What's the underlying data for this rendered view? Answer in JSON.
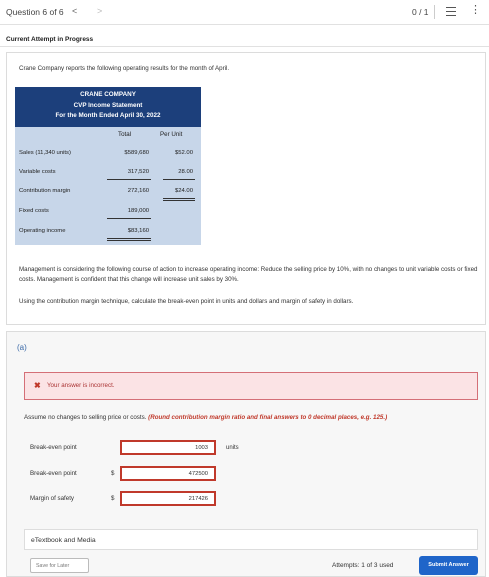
{
  "header": {
    "question_label": "Question 6 of 6",
    "prev_arrow": "<",
    "next_arrow": ">",
    "score": "0 / 1",
    "list_icon": "list-icon",
    "more_icon": "more-vertical-icon"
  },
  "status": "Current Attempt in Progress",
  "question": {
    "intro": "Crane Company reports the following operating results for the month of April.",
    "statement": {
      "company": "CRANE COMPANY",
      "title": "CVP Income Statement",
      "period": "For the Month Ended April 30, 2022",
      "col_total": "Total",
      "col_per_unit": "Per Unit",
      "rows": [
        {
          "label": "Sales (11,340 units)",
          "total": "$589,680",
          "per_unit": "$52.00"
        },
        {
          "label": "Variable costs",
          "total": "317,520",
          "per_unit": "28.00"
        },
        {
          "label": "Contribution margin",
          "total": "272,160",
          "per_unit": "$24.00"
        },
        {
          "label": "Fixed costs",
          "total": "189,000",
          "per_unit": ""
        },
        {
          "label": "Operating income",
          "total": "$83,160",
          "per_unit": ""
        }
      ]
    },
    "management": "Management is considering the following course of action to increase operating income: Reduce the selling price by 10%, with no changes to unit variable costs or fixed costs. Management is confident that this change will increase unit sales by 30%.",
    "instruction": "Using the contribution margin technique, calculate the break-even point in units and dollars and margin of safety in dollars."
  },
  "part_a": {
    "label": "(a)",
    "alert_message": "Your answer is incorrect.",
    "assume_text": "Assume no changes to selling price or costs.",
    "assume_note": "(Round contribution margin ratio and final answers to 0 decimal places, e.g. 125.)",
    "answers": [
      {
        "label": "Break-even point",
        "prefix": "",
        "value": "1003",
        "suffix": "units"
      },
      {
        "label": "Break-even point",
        "prefix": "$",
        "value": "472500",
        "suffix": ""
      },
      {
        "label": "Margin of safety",
        "prefix": "$",
        "value": "217426",
        "suffix": ""
      }
    ],
    "etextbook": "eTextbook and Media",
    "save_label": "Save for Later",
    "attempts": "Attempts: 1 of 3 used",
    "submit_label": "Submit Answer"
  }
}
